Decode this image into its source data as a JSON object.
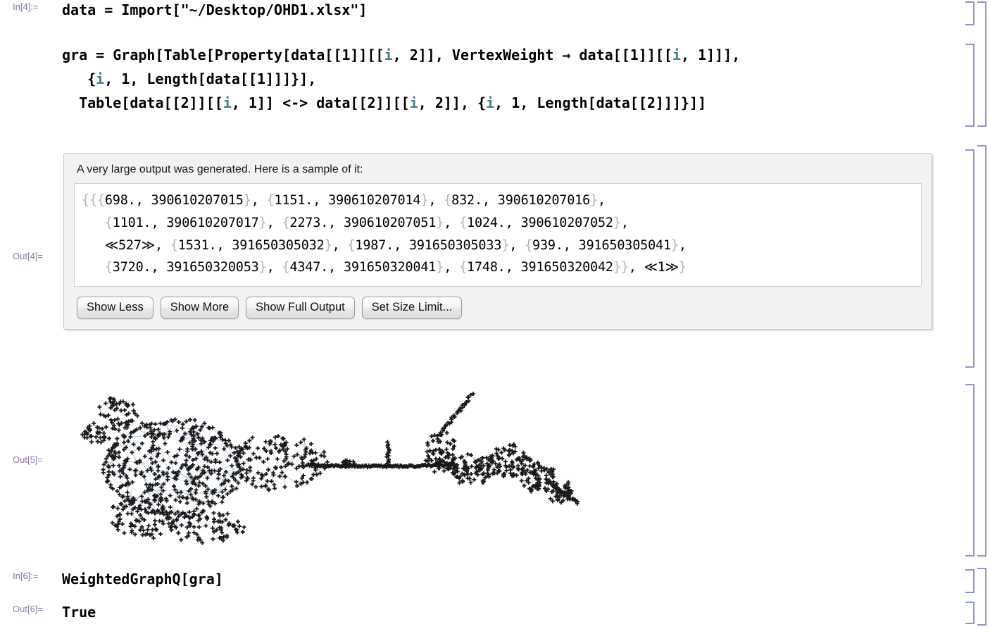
{
  "app": {
    "kind": "mathematica-notebook",
    "accent_in_label": "#6f77b5",
    "accent_out_label": "#8f7ba8",
    "bracket_color": "#9096c8",
    "code_color": "#000000",
    "variable_color": "#4a7c8c",
    "brace_color": "#b4b4b4"
  },
  "cells": {
    "in4": {
      "label": "In[4]:=",
      "code": "data = Import[\"~/Desktop/OHD1.xlsx\"]"
    },
    "in5": {
      "label": "",
      "code_lines": [
        "gra = Graph[Table[Property[data[[1]][[i, 2]], VertexWeight → data[[1]][[i, 1]]],",
        "   {i, 1, Length[data[[1]]]}],",
        "  Table[data[[2]][[i, 1]] <-> data[[2]][[i, 2]], {i, 1, Length[data[[2]]]}]]"
      ]
    },
    "out4": {
      "label": "Out[4]=",
      "message": "A very large output was generated. Here is a sample of it:",
      "sample_lines": [
        "{{{698., 390610207015}, {1151., 390610207014}, {832., 390610207016},",
        "   {1101., 390610207017}, {2273., 390610207051}, {1024., 390610207052},",
        "   ≪527≫, {1531., 391650305032}, {1987., 391650305033}, {939., 391650305041},",
        "   {3720., 391650320053}, {4347., 391650320041}, {1748., 391650320042}}, ≪1≫}"
      ],
      "buttons": [
        {
          "label": "Show Less",
          "name": "show-less-button"
        },
        {
          "label": "Show More",
          "name": "show-more-button"
        },
        {
          "label": "Show Full Output",
          "name": "show-full-output-button"
        },
        {
          "label": "Set Size Limit...",
          "name": "set-size-limit-button"
        }
      ]
    },
    "out5": {
      "label": "Out[5]=",
      "graphic": {
        "type": "network-graph",
        "description": "Large weighted graph layout rendered as a dense cluster of cross-shaped vertices joined by pale blue edges, forming a wide mass on the left, a long thin filament across the middle, and a secondary cluster on the right.",
        "vertex_marker": "plus-cross",
        "vertex_color": "#1a1a1a",
        "edge_color": "#7f9dc4"
      }
    },
    "in6": {
      "label": "In[6]:=",
      "code": "WeightedGraphQ[gra]"
    },
    "out6": {
      "label": "Out[6]=",
      "value": "True"
    }
  }
}
